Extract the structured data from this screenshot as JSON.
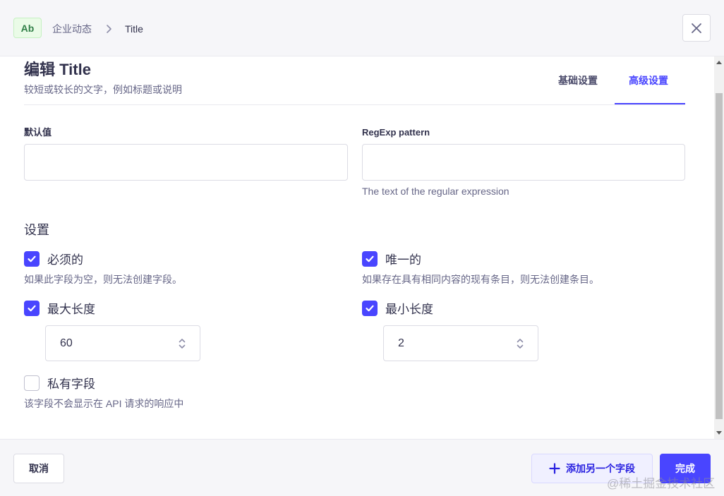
{
  "header": {
    "type_badge": "Ab",
    "breadcrumb_parent": "企业动态",
    "breadcrumb_current": "Title"
  },
  "modal": {
    "title": "编辑 Title",
    "subtitle": "较短或较长的文字，例如标题或说明",
    "tabs": [
      {
        "label": "基础设置",
        "active": false
      },
      {
        "label": "高级设置",
        "active": true
      }
    ]
  },
  "fields": {
    "default_value": {
      "label": "默认值",
      "value": ""
    },
    "regexp": {
      "label": "RegExp pattern",
      "value": "",
      "hint": "The text of the regular expression"
    }
  },
  "settings": {
    "title": "设置",
    "required": {
      "label": "必须的",
      "checked": true,
      "description": "如果此字段为空，则无法创建字段。"
    },
    "unique": {
      "label": "唯一的",
      "checked": true,
      "description": "如果存在具有相同内容的现有条目，则无法创建条目。"
    },
    "max_length": {
      "label": "最大长度",
      "checked": true,
      "value": "60"
    },
    "min_length": {
      "label": "最小长度",
      "checked": true,
      "value": "2"
    },
    "private": {
      "label": "私有字段",
      "checked": false,
      "description": "该字段不会显示在 API 请求的响应中"
    }
  },
  "footer": {
    "cancel_label": "取消",
    "add_field_label": "添加另一个字段",
    "done_label": "完成"
  },
  "watermark": "@稀土掘金技术社区",
  "colors": {
    "primary": "#4945ff",
    "badge_bg": "#eafbe7",
    "badge_text": "#328048",
    "header_bg": "#f6f6f9"
  }
}
